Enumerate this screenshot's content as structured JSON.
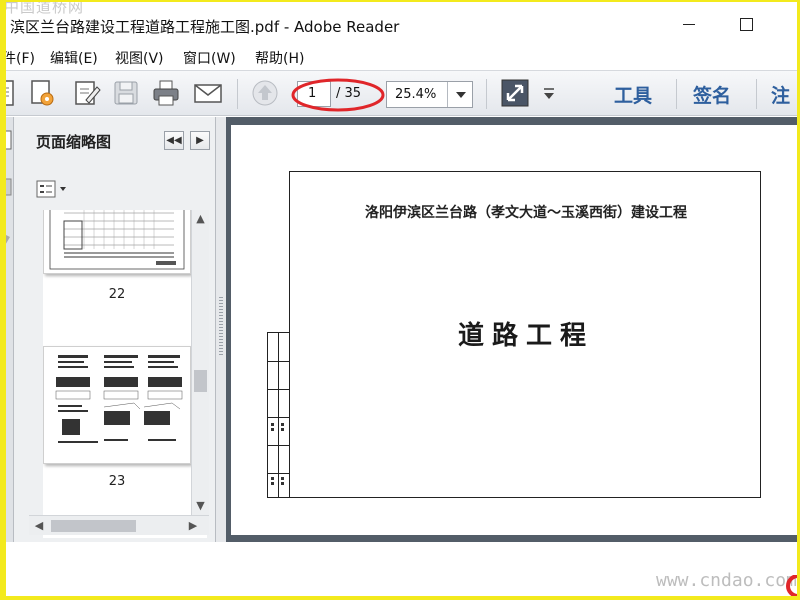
{
  "window": {
    "title": "滨区兰台路建设工程道路工程施工图.pdf - Adobe Reader",
    "minimize_label": "—",
    "maximize_label": "□"
  },
  "watermarks": {
    "top": "中国道桥网",
    "bottom": "www.cndao.com"
  },
  "menu": {
    "items": [
      {
        "label": "件(F)"
      },
      {
        "label": "编辑(E)"
      },
      {
        "label": "视图(V)"
      },
      {
        "label": "窗口(W)"
      },
      {
        "label": "帮助(H)"
      }
    ]
  },
  "toolbar": {
    "icons": [
      "open-document-icon",
      "create-pdf-icon",
      "edit-icon",
      "save-icon",
      "print-icon",
      "email-icon",
      "previous-page-icon",
      "fit-page-icon"
    ],
    "page_current": "1",
    "page_total": "/ 35",
    "zoom": "25.4%",
    "tools_label": "工具",
    "sign_label": "签名",
    "comment_label": "注",
    "highlight_color": "#e0262a"
  },
  "thumbnails_panel": {
    "title": "页面缩略图",
    "prev_label": "◀◀",
    "next_label": "▶",
    "pages": [
      {
        "number": "22"
      },
      {
        "number": "23"
      }
    ]
  },
  "document": {
    "subtitle": "洛阳伊滨区兰台路（孝文大道～玉溪西街）建设工程",
    "title": "道路工程"
  }
}
